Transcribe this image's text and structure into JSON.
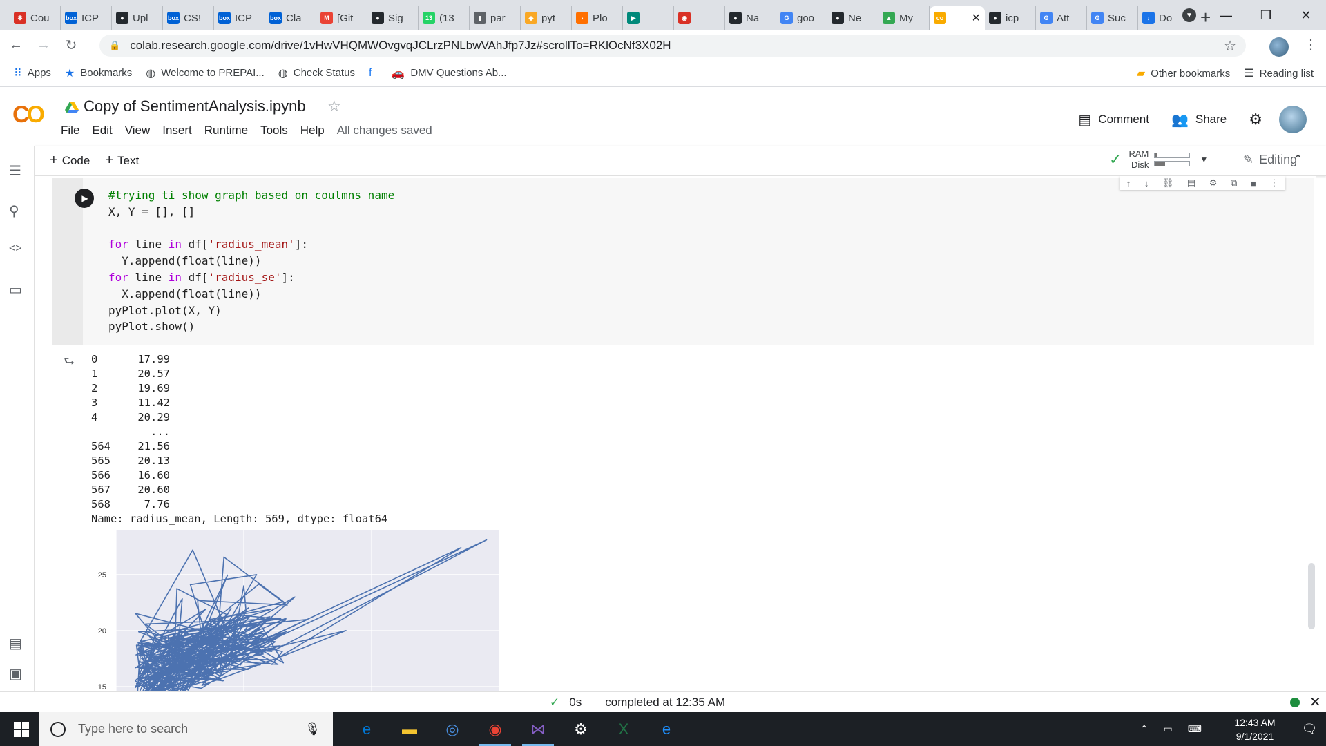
{
  "browser": {
    "tabs": [
      {
        "label": "Cou",
        "icon": "gear-icon",
        "color": "#d93025"
      },
      {
        "label": "ICP",
        "icon": "box-icon",
        "color": "#0061d5"
      },
      {
        "label": "Upl",
        "icon": "github-icon",
        "color": "#24292e"
      },
      {
        "label": "CS!",
        "icon": "box-icon",
        "color": "#0061d5"
      },
      {
        "label": "ICP",
        "icon": "box-icon",
        "color": "#0061d5"
      },
      {
        "label": "Cla",
        "icon": "box-icon",
        "color": "#0061d5"
      },
      {
        "label": "[Git",
        "icon": "gmail-icon",
        "color": "#ea4335"
      },
      {
        "label": "Sig",
        "icon": "github-icon",
        "color": "#24292e"
      },
      {
        "label": "(13",
        "icon": "whatsapp-icon",
        "color": "#25d366"
      },
      {
        "label": "par",
        "icon": "chart-icon",
        "color": "#5f6368"
      },
      {
        "label": "pyt",
        "icon": "python-icon",
        "color": "#f9a825"
      },
      {
        "label": "Plo",
        "icon": "arrow-icon",
        "color": "#ff6f00"
      },
      {
        "label": "",
        "icon": "meet-icon",
        "color": "#00897b"
      },
      {
        "label": "",
        "icon": "record-icon",
        "color": "#d93025"
      },
      {
        "label": "Na",
        "icon": "github-icon",
        "color": "#24292e"
      },
      {
        "label": "goo",
        "icon": "google-icon",
        "color": "#4285f4"
      },
      {
        "label": "Ne",
        "icon": "github-icon",
        "color": "#24292e"
      },
      {
        "label": "My",
        "icon": "drive-icon",
        "color": "#34a853"
      },
      {
        "label": "",
        "icon": "colab-icon",
        "color": "#f9ab00",
        "active": true
      },
      {
        "label": "icp",
        "icon": "github-icon",
        "color": "#24292e"
      },
      {
        "label": "Att",
        "icon": "google-icon",
        "color": "#4285f4"
      },
      {
        "label": "Suc",
        "icon": "google-icon",
        "color": "#4285f4"
      },
      {
        "label": "Do",
        "icon": "download-icon",
        "color": "#1a73e8"
      }
    ],
    "url": "colab.research.google.com/drive/1vHwVHQMWOvgvqJCLrzPNLbwVAhJfp7Jz#scrollTo=RKlOcNf3X02H",
    "bookmarks": [
      {
        "label": "Apps",
        "icon": "apps-grid-icon"
      },
      {
        "label": "Bookmarks",
        "icon": "star-icon"
      },
      {
        "label": "Welcome to PREPAI...",
        "icon": "globe-icon"
      },
      {
        "label": "Check Status",
        "icon": "globe-icon"
      },
      {
        "label": "",
        "icon": "facebook-icon"
      },
      {
        "label": "DMV Questions Ab...",
        "icon": "car-icon"
      }
    ],
    "other_bookmarks": "Other bookmarks",
    "reading_list": "Reading list"
  },
  "colab": {
    "title": "Copy of SentimentAnalysis.ipynb",
    "menu": [
      "File",
      "Edit",
      "View",
      "Insert",
      "Runtime",
      "Tools",
      "Help"
    ],
    "save_status": "All changes saved",
    "comment_label": "Comment",
    "share_label": "Share",
    "add_code": "Code",
    "add_text": "Text",
    "ram_label": "RAM",
    "disk_label": "Disk",
    "ram_usage": 0.05,
    "disk_usage": 0.3,
    "mode_label": "Editing",
    "status": {
      "duration": "0s",
      "message": "completed at 12:35 AM"
    },
    "accent": "#f9ab00"
  },
  "cell": {
    "code_lines": [
      "#trying ti show graph based on coulmns name",
      "X, Y = [], []",
      "",
      "for line in df['radius_mean']:",
      "  Y.append(float(line))",
      "for line in df['radius_se']:",
      "  X.append(float(line))",
      "pyPlot.plot(X, Y)",
      "pyPlot.show()"
    ],
    "output_rows": [
      {
        "i": "0",
        "v": "17.99"
      },
      {
        "i": "1",
        "v": "20.57"
      },
      {
        "i": "2",
        "v": "19.69"
      },
      {
        "i": "3",
        "v": "11.42"
      },
      {
        "i": "4",
        "v": "20.29"
      },
      {
        "i": "",
        "v": "..."
      },
      {
        "i": "564",
        "v": "21.56"
      },
      {
        "i": "565",
        "v": "20.13"
      },
      {
        "i": "566",
        "v": "16.60"
      },
      {
        "i": "567",
        "v": "20.60"
      },
      {
        "i": "568",
        "v": "7.76"
      }
    ],
    "output_footer": "Name: radius_mean, Length: 569, dtype: float64"
  },
  "chart_data": {
    "type": "line",
    "title": "",
    "xlabel": "",
    "ylabel": "",
    "yticks": [
      25,
      20,
      15
    ],
    "grid": true,
    "series_color": "#4c72b0",
    "background": "#eaeaf2",
    "note_values": {
      "x": [
        0.2,
        0.6,
        0.3,
        0.9,
        0.4,
        1.1,
        0.5,
        1.4,
        0.35,
        2.7,
        0.45,
        2.9,
        0.3,
        1.8,
        0.6,
        1.0,
        0.25,
        0.8,
        0.5,
        1.5
      ],
      "y": [
        13,
        27.2,
        14,
        22,
        16,
        25,
        14.5,
        23,
        15,
        27.4,
        16.5,
        28.1,
        13.8,
        20,
        15.2,
        24,
        13.5,
        19,
        15.8,
        21
      ]
    },
    "xlim": [
      0,
      3.0
    ],
    "ylim": [
      14.2,
      29
    ]
  },
  "taskbar": {
    "search_placeholder": "Type here to search",
    "time": "12:43 AM",
    "date": "9/1/2021",
    "apps": [
      {
        "icon": "edge-icon",
        "color": "#0078d7"
      },
      {
        "icon": "file-explorer-icon",
        "color": "#f4c430"
      },
      {
        "icon": "chrome-alt-icon",
        "color": "#4a90e2"
      },
      {
        "icon": "chrome-icon",
        "color": "#ea4335",
        "running": true
      },
      {
        "icon": "visual-studio-icon",
        "color": "#865fc5",
        "running": true
      },
      {
        "icon": "settings-icon",
        "color": "#ffffff"
      },
      {
        "icon": "excel-icon",
        "color": "#217346"
      },
      {
        "icon": "ie-icon",
        "color": "#1e90ff"
      }
    ]
  }
}
